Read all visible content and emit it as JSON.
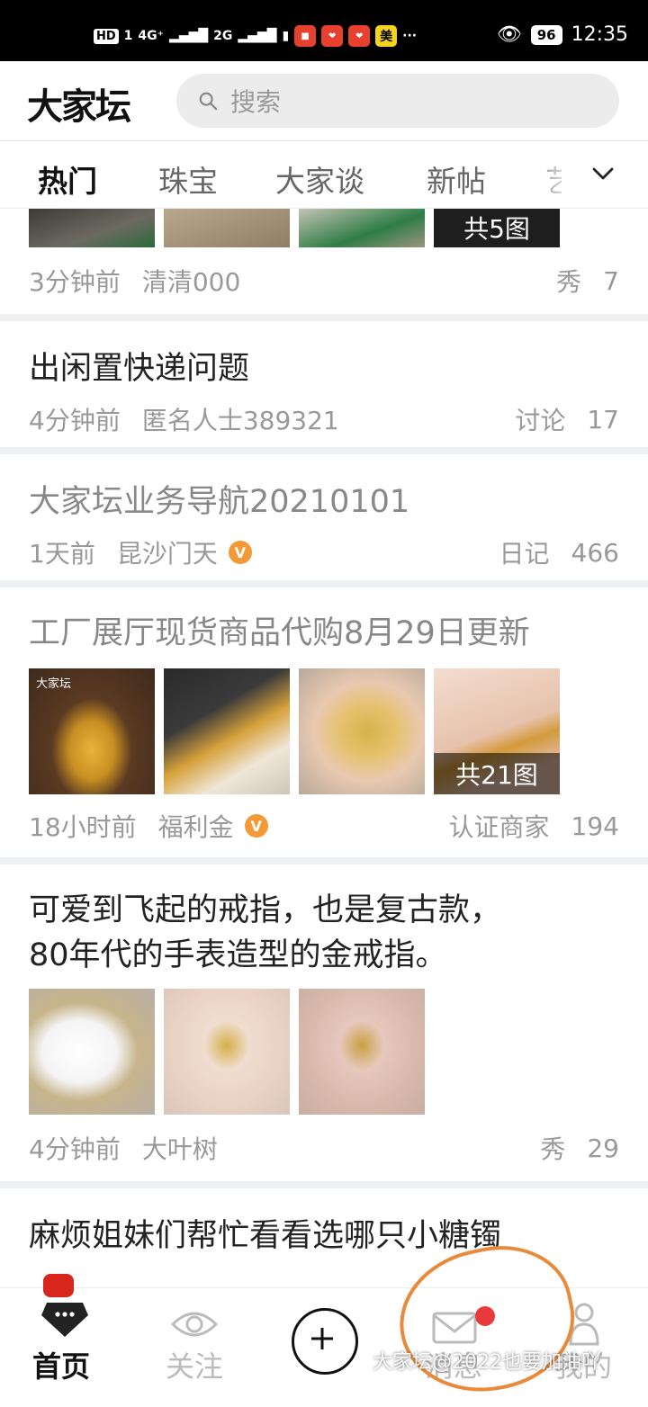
{
  "status_bar": {
    "hd": "HD",
    "sim": "1",
    "net1": "4G⁺",
    "net2": "2G",
    "app_badge": "美",
    "dots": "···",
    "battery": "96",
    "time": "12:35"
  },
  "header": {
    "logo": "大家坛",
    "search_placeholder": "搜索"
  },
  "tabs": [
    "热门",
    "珠宝",
    "大家谈",
    "新帖",
    "艺"
  ],
  "feed": {
    "card0": {
      "time": "3分钟前",
      "author": "清清000",
      "category": "秀",
      "count": "7",
      "image_count": "共5图"
    },
    "card1": {
      "title": "出闲置快递问题",
      "time": "4分钟前",
      "author": "匿名人士389321",
      "category": "讨论",
      "count": "17"
    },
    "card2": {
      "title": "大家坛业务导航20210101",
      "time": "1天前",
      "author": "昆沙门天",
      "category": "日记",
      "count": "466"
    },
    "card3": {
      "title": "工厂展厅现货商品代购8月29日更新",
      "time": "18小时前",
      "author": "福利金",
      "category": "认证商家",
      "count": "194",
      "image_count": "共21图",
      "img_logo": "大家坛"
    },
    "card4": {
      "title_line1": "可爱到飞起的戒指，也是复古款，",
      "title_line2": "80年代的手表造型的金戒指。",
      "time": "4分钟前",
      "author": "大叶树",
      "category": "秀",
      "count": "29"
    },
    "card5": {
      "title": "麻烦姐妹们帮忙看看选哪只小糖镯"
    }
  },
  "verified_badge": "V",
  "bottom_nav": {
    "home": "首页",
    "follow": "关注",
    "message": "消息",
    "me": "我的"
  },
  "watermark": "大家坛@2022也要加油吖",
  "colors": {
    "accent": "#e9893a",
    "badge": "#f29a38",
    "dot": "#e83a3a"
  }
}
